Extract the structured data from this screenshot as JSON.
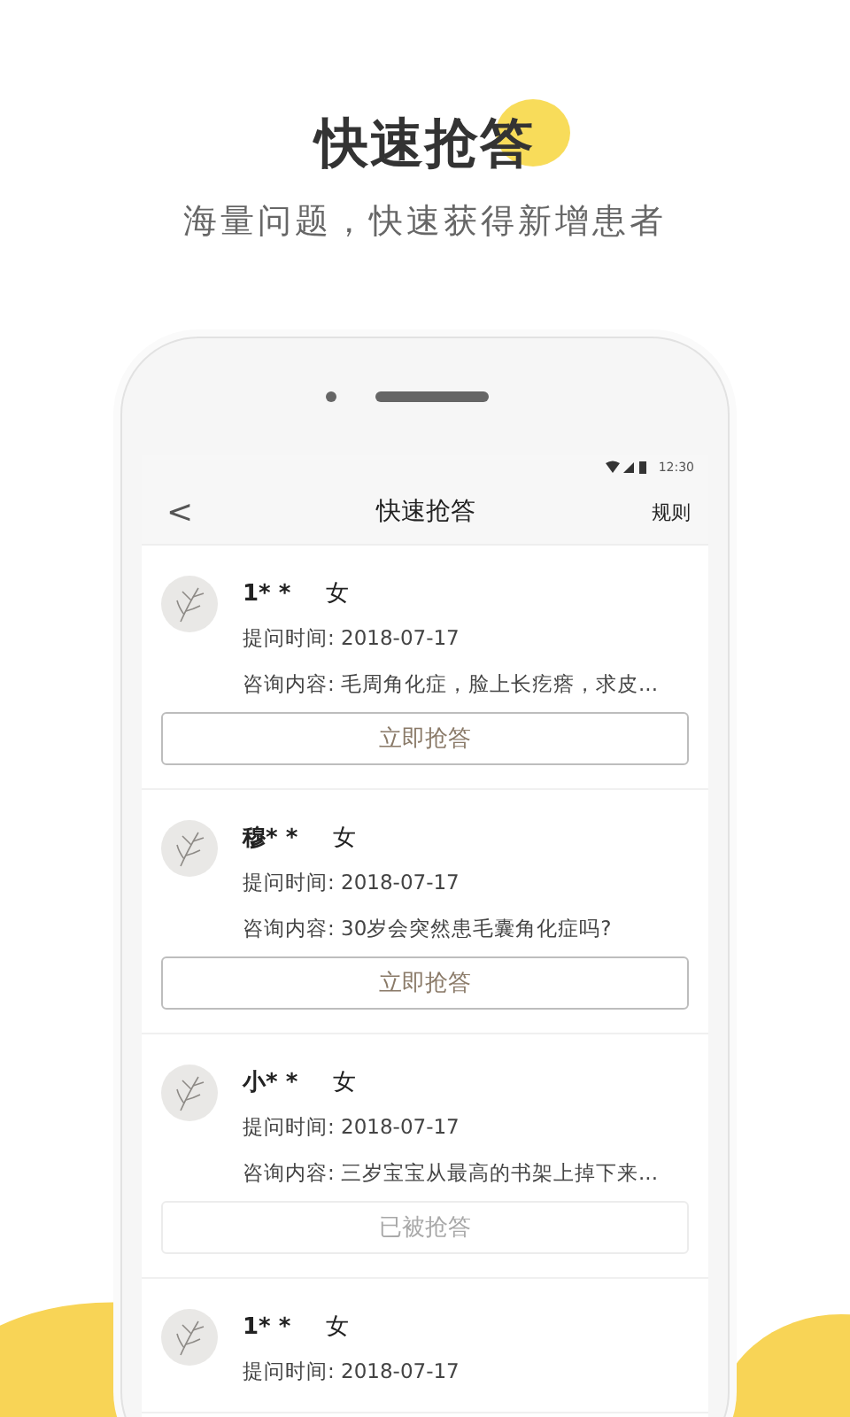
{
  "headline": "快速抢答",
  "subtitle": "海量问题，快速获得新增患者",
  "status_bar": {
    "time": "12:30"
  },
  "nav": {
    "back": "<",
    "title": "快速抢答",
    "action": "规则"
  },
  "questions": [
    {
      "name": "1* *",
      "gender": "女",
      "time": "提问时间: 2018-07-17",
      "content": "咨询内容: 毛周角化症，脸上长疙瘩，求皮...",
      "button": {
        "label": "立即抢答",
        "disabled": false
      }
    },
    {
      "name": "穆* *",
      "gender": "女",
      "time": "提问时间: 2018-07-17",
      "content": "咨询内容: 30岁会突然患毛囊角化症吗?",
      "button": {
        "label": "立即抢答",
        "disabled": false
      }
    },
    {
      "name": "小* *",
      "gender": "女",
      "time": "提问时间: 2018-07-17",
      "content": "咨询内容: 三岁宝宝从最高的书架上掉下来...",
      "button": {
        "label": "已被抢答",
        "disabled": true
      }
    },
    {
      "name": "1* *",
      "gender": "女",
      "time": "提问时间: 2018-07-17"
    }
  ]
}
